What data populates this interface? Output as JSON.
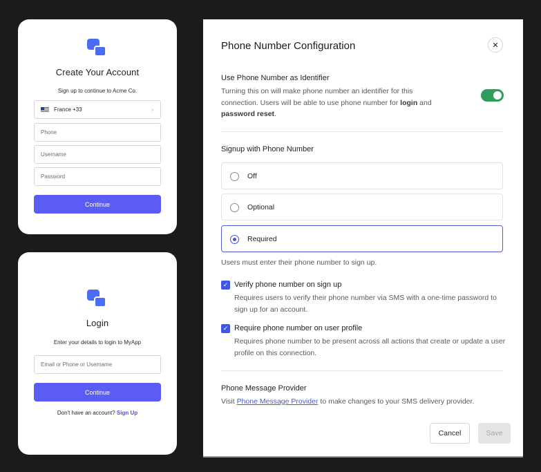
{
  "signup_card": {
    "title": "Create Your Account",
    "subtitle": "Sign up to continue to Acme Co.",
    "country_value": "France +33",
    "phone_placeholder": "Phone",
    "username_placeholder": "Username",
    "password_placeholder": "Password",
    "continue_label": "Continue",
    "logo_icon": "brand-logo-icon",
    "flag_icon": "flag-icon",
    "chevron_icon": "chevron-right-icon"
  },
  "login_card": {
    "title": "Login",
    "subtitle": "Enter your details to login to MyApp",
    "identifier_placeholder": "Email or Phone or Username",
    "continue_label": "Continue",
    "signup_prompt": "Don't have an account?",
    "signup_link": "Sign Up",
    "logo_icon": "brand-logo-icon"
  },
  "modal": {
    "title": "Phone Number Configuration",
    "close_icon": "close-icon",
    "identifier_section": {
      "title": "Use Phone Number as Identifier",
      "desc_part1": "Turning this on will make phone number an identifier for this connection. Users will be able to use phone number for ",
      "desc_bold1": "login",
      "desc_part2": " and ",
      "desc_bold2": "password reset",
      "desc_part3": ".",
      "toggle_on": true
    },
    "signup_section": {
      "title": "Signup with Phone Number",
      "options": [
        {
          "label": "Off",
          "selected": false
        },
        {
          "label": "Optional",
          "selected": false
        },
        {
          "label": "Required",
          "selected": true
        }
      ],
      "helper": "Users must enter their phone number to sign up."
    },
    "checks": [
      {
        "title": "Verify phone number on sign up",
        "desc": "Requires users to verify their phone number via SMS with a one-time password to sign up for an account.",
        "checked": true
      },
      {
        "title": "Require phone number on user profile",
        "desc": "Requires phone number to be present across all actions that create or update a user profile on this connection.",
        "checked": true
      }
    ],
    "provider_section": {
      "title": "Phone Message Provider",
      "prefix": "Visit ",
      "link": "Phone Message Provider",
      "suffix": " to make changes to your SMS delivery provider."
    },
    "cancel_label": "Cancel",
    "save_label": "Save"
  },
  "colors": {
    "page_bg": "#1b1b1b",
    "primary_button": "#5b5cf6",
    "brand_logo": "#4a6cf7",
    "toggle_on": "#2e9e5b",
    "checkbox": "#3f58e3",
    "link": "#4b58cf"
  }
}
